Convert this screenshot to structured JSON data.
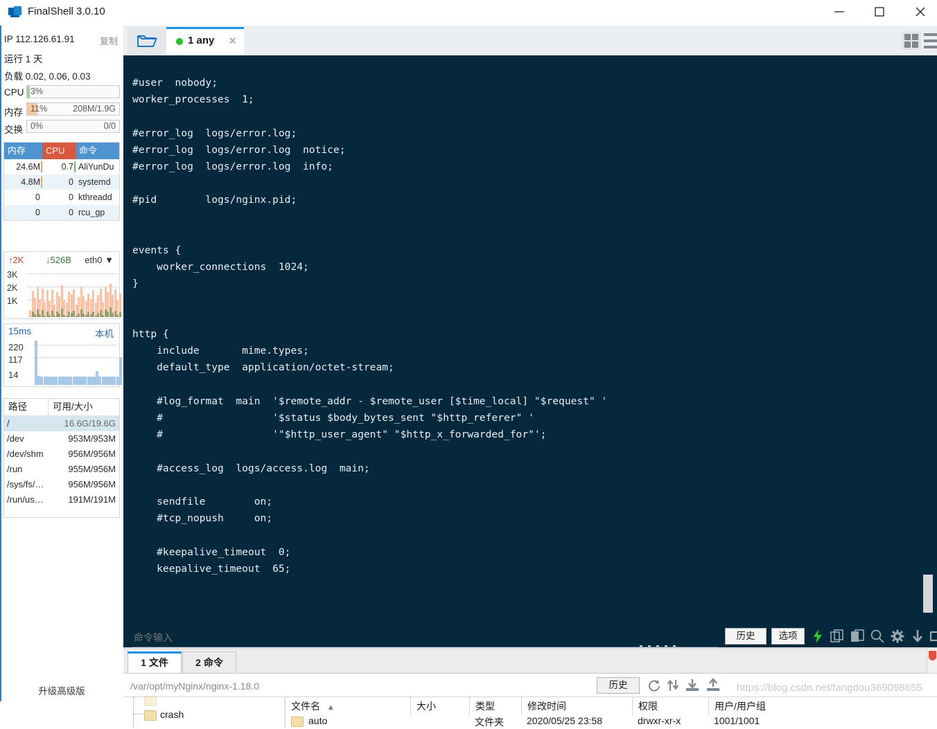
{
  "window": {
    "title": "FinalShell 3.0.10",
    "minimize_label": "minimize",
    "maximize_label": "maximize",
    "close_label": "close"
  },
  "sidebar": {
    "ip_label": "IP 112.126.61.91",
    "copy_label": "复制",
    "uptime_label": "运行 1 天",
    "load_label": "负载 0.02, 0.06, 0.03",
    "meters": [
      {
        "key": "CPU",
        "percent": "3%",
        "right": "",
        "fill_pct": 3,
        "color": "#9ed49b"
      },
      {
        "key": "内存",
        "percent": "11%",
        "right": "208M/1.9G",
        "fill_pct": 11,
        "color": "#f7c9a3"
      },
      {
        "key": "交换",
        "percent": "0%",
        "right": "0/0",
        "fill_pct": 0,
        "color": "#f7c9a3"
      }
    ],
    "process_table": {
      "headers": [
        "内存",
        "CPU",
        "命令"
      ],
      "rows": [
        {
          "mem": "24.6M",
          "cpu": "0.7",
          "cmd": "AliYunDu"
        },
        {
          "mem": "4.8M",
          "cpu": "0",
          "cmd": "systemd"
        },
        {
          "mem": "0",
          "cpu": "0",
          "cmd": "kthreadd"
        },
        {
          "mem": "0",
          "cpu": "0",
          "cmd": "rcu_gp"
        }
      ]
    },
    "network": {
      "upload": "2K",
      "download": "526B",
      "interface": "eth0",
      "y_labels": [
        "3K",
        "2K",
        "1K"
      ]
    },
    "ping": {
      "latency": "15ms",
      "host": "本机",
      "y_labels": [
        "220",
        "117",
        "14"
      ]
    },
    "disk_table": {
      "headers": [
        "路径",
        "可用/大小"
      ],
      "rows": [
        {
          "path": "/",
          "usage": "16.6G/19.6G",
          "selected": true
        },
        {
          "path": "/dev",
          "usage": "953M/953M",
          "selected": false
        },
        {
          "path": "/dev/shm",
          "usage": "956M/956M",
          "selected": false
        },
        {
          "path": "/run",
          "usage": "955M/956M",
          "selected": false
        },
        {
          "path": "/sys/fs/…",
          "usage": "956M/956M",
          "selected": false
        },
        {
          "path": "/run/us…",
          "usage": "191M/191M",
          "selected": false
        }
      ]
    },
    "upgrade_label": "升级高级版"
  },
  "tabbar": {
    "open_icon": "open-folder-icon",
    "tab_label": "1 any",
    "tab_close": "✕",
    "grid_view_icon": "grid-view-icon",
    "list_view_icon": "list-view-icon"
  },
  "terminal": {
    "background": "#06283d",
    "foreground": "#e8eef3",
    "content": "#user  nobody;\nworker_processes  1;\n\n#error_log  logs/error.log;\n#error_log  logs/error.log  notice;\n#error_log  logs/error.log  info;\n\n#pid        logs/nginx.pid;\n\n\nevents {\n    worker_connections  1024;\n}\n\n\nhttp {\n    include       mime.types;\n    default_type  application/octet-stream;\n\n    #log_format  main  '$remote_addr - $remote_user [$time_local] \"$request\" '\n    #                  '$status $body_bytes_sent \"$http_referer\" '\n    #                  '\"$http_user_agent\" \"$http_x_forwarded_for\"';\n\n    #access_log  logs/access.log  main;\n\n    sendfile        on;\n    #tcp_nopush     on;\n\n    #keepalive_timeout  0;\n    keepalive_timeout  65;\n"
  },
  "command_bar": {
    "placeholder": "命令输入",
    "value": "",
    "history_label": "历史",
    "options_label": "选项",
    "icons": [
      {
        "name": "lightning-icon",
        "glyph": "⚡"
      },
      {
        "name": "copy-icon",
        "glyph": "copy"
      },
      {
        "name": "paste-icon",
        "glyph": "paste"
      },
      {
        "name": "search-icon",
        "glyph": "search"
      },
      {
        "name": "gear-icon",
        "glyph": "gear"
      },
      {
        "name": "download-icon",
        "glyph": "down"
      },
      {
        "name": "window-icon",
        "glyph": "window"
      }
    ]
  },
  "bottom_panel": {
    "tabs": [
      {
        "label": "1 文件",
        "active": true
      },
      {
        "label": "2 命令",
        "active": false
      }
    ],
    "path_value": "/var/opt/myNginx/nginx-1.18.0",
    "history_label": "历史",
    "toolbar_icons": [
      {
        "name": "refresh-icon"
      },
      {
        "name": "transfer-icon"
      },
      {
        "name": "download-file-icon"
      },
      {
        "name": "upload-file-icon"
      }
    ],
    "tree": [
      {
        "label": "crash"
      }
    ],
    "file_columns": [
      "文件名",
      "大小",
      "类型",
      "修改时间",
      "权限",
      "用户/用户组"
    ],
    "sort_indicator": "▲",
    "file_rows": [
      {
        "name": "auto",
        "size": "",
        "type": "文件夹",
        "modified": "2020/05/25 23:58",
        "perm": "drwxr-xr-x",
        "owner": "1001/1001"
      }
    ]
  },
  "watermark": "https://blog.csdn.net/tangdou369098655"
}
